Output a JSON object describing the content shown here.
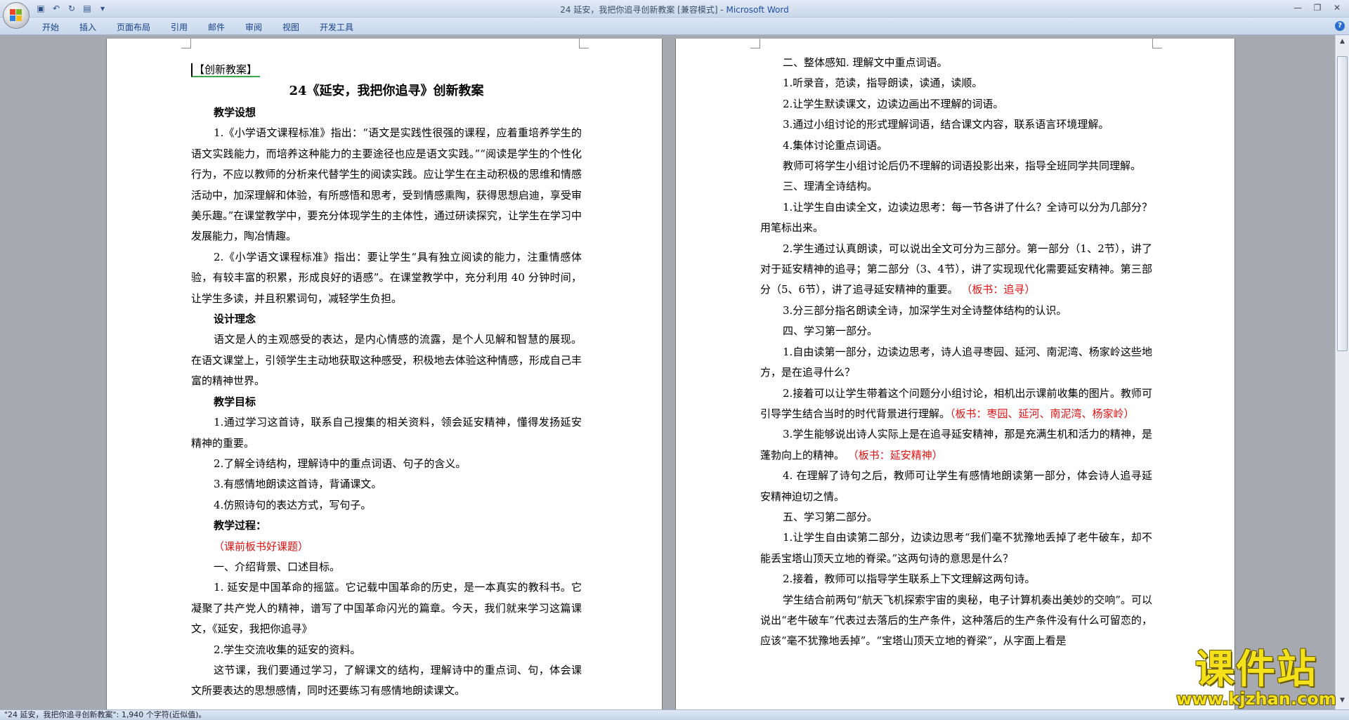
{
  "window": {
    "title_doc": "24 延安，我把你追寻创新教案 [兼容模式] - ",
    "title_app": "Microsoft Word"
  },
  "ribbon": {
    "tabs": [
      "开始",
      "插入",
      "页面布局",
      "引用",
      "邮件",
      "审阅",
      "视图",
      "开发工具"
    ]
  },
  "left_page": {
    "tag": "【创新教案】",
    "title": "24《延安，我把你追寻》创新教案",
    "paragraphs": [
      {
        "text": "教学设想",
        "style": "bold"
      },
      {
        "text": "1.《小学语文课程标准》指出：“语文是实践性很强的课程，应着重培养学生的语文实践能力，而培养这种能力的主要途径也应是语文实践。”“阅读是学生的个性化行为，不应以教师的分析来代替学生的阅读实践。应让学生在主动积极的思维和情感活动中，加深理解和体验，有所感悟和思考，受到情感熏陶，获得思想启迪，享受审美乐趣。”在课堂教学中，要充分体现学生的主体性，通过研读探究，让学生在学习中发展能力，陶冶情趣。",
        "style": "normal"
      },
      {
        "text": "2.《小学语文课程标准》指出：要让学生“具有独立阅读的能力，注重情感体验，有较丰富的积累，形成良好的语感”。在课堂教学中，充分利用 40 分钟时间，让学生多读，并且积累词句，减轻学生负担。",
        "style": "normal"
      },
      {
        "text": "设计理念",
        "style": "bold"
      },
      {
        "text": "语文是人的主观感受的表达，是内心情感的流露，是个人见解和智慧的展现。在语文课堂上，引领学生主动地获取这种感受，积极地去体验这种情感，形成自己丰富的精神世界。",
        "style": "normal"
      },
      {
        "text": "教学目标",
        "style": "bold"
      },
      {
        "text": "1.通过学习这首诗，联系自己搜集的相关资料，领会延安精神，懂得发扬延安精神的重要。",
        "style": "normal"
      },
      {
        "text": "2.了解全诗结构，理解诗中的重点词语、句子的含义。",
        "style": "normal"
      },
      {
        "text": "3.有感情地朗读这首诗，背诵课文。",
        "style": "normal"
      },
      {
        "text": "4.仿照诗句的表达方式，写句子。",
        "style": "normal"
      },
      {
        "text": "教学过程：",
        "style": "bold"
      },
      {
        "text": "（课前板书好课题）",
        "style": "red"
      },
      {
        "text": "一、介绍背景、口述目标。",
        "style": "normal"
      },
      {
        "text": "1. 延安是中国革命的摇篮。它记载中国革命的历史，是一本真实的教科书。它凝聚了共产党人的精神，谱写了中国革命闪光的篇章。今天，我们就来学习这篇课文，《延安，我把你追寻》",
        "style": "normal"
      },
      {
        "text": "2.学生交流收集的延安的资料。",
        "style": "normal"
      },
      {
        "text": "这节课，我们要通过学习，了解课文的结构，理解诗中的重点词、句，体会课文所要表达的思想感情，同时还要练习有感情地朗读课文。",
        "style": "normal"
      }
    ]
  },
  "right_page": {
    "paragraphs": [
      {
        "parts": [
          {
            "text": "二、整体感知. 理解文中重点词语。",
            "color": "black"
          }
        ]
      },
      {
        "parts": [
          {
            "text": "1.听录音，范读，指导朗读，读通，读顺。",
            "color": "black"
          }
        ]
      },
      {
        "parts": [
          {
            "text": "2.让学生默读课文，边读边画出不理解的词语。",
            "color": "black"
          }
        ]
      },
      {
        "parts": [
          {
            "text": "3.通过小组讨论的形式理解词语，结合课文内容，联系语言环境理解。",
            "color": "black"
          }
        ]
      },
      {
        "parts": [
          {
            "text": "4.集体讨论重点词语。",
            "color": "black"
          }
        ]
      },
      {
        "parts": [
          {
            "text": "教师可将学生小组讨论后仍不理解的词语投影出来，指导全班同学共同理解。",
            "color": "black"
          }
        ]
      },
      {
        "parts": [
          {
            "text": "三、理清全诗结构。",
            "color": "black"
          }
        ]
      },
      {
        "parts": [
          {
            "text": "1.让学生自由读全文，边读边思考：每一节各讲了什么？全诗可以分为几部分？用笔标出来。",
            "color": "black"
          }
        ]
      },
      {
        "parts": [
          {
            "text": "2.学生通过认真朗读，可以说出全文可分为三部分。第一部分（1、2节），讲了对于延安精神的追寻；第二部分（3、4节），讲了实现现代化需要延安精神。第三部分（5、6节），讲了追寻延安精神的重要。",
            "color": "black"
          },
          {
            "text": " （板书：追寻）",
            "color": "red"
          }
        ]
      },
      {
        "parts": [
          {
            "text": "3.分三部分指名朗读全诗，加深学生对全诗整体结构的认识。",
            "color": "black"
          }
        ]
      },
      {
        "parts": [
          {
            "text": "四、学习第一部分。",
            "color": "black"
          }
        ]
      },
      {
        "parts": [
          {
            "text": "1.自由读第一部分，边读边思考，诗人追寻枣园、延河、南泥湾、杨家岭这些地方，是在追寻什么？",
            "color": "black"
          }
        ]
      },
      {
        "parts": [
          {
            "text": "2.接着可以让学生带着这个问题分小组讨论，相机出示课前收集的图片。教师可引导学生结合当时的时代背景进行理解。",
            "color": "black"
          },
          {
            "text": "（板书：枣园、延河、南泥湾、杨家岭）",
            "color": "red"
          }
        ]
      },
      {
        "parts": [
          {
            "text": "3.学生能够说出诗人实际上是在追寻延安精神，那是充满生机和活力的精神，是蓬勃向上的精神。",
            "color": "black"
          },
          {
            "text": " （板书：延安精神）",
            "color": "red"
          }
        ]
      },
      {
        "parts": [
          {
            "text": "4. 在理解了诗句之后，教师可让学生有感情地朗读第一部分，体会诗人追寻延安精神迫切之情。",
            "color": "black"
          }
        ]
      },
      {
        "parts": [
          {
            "text": "五、学习第二部分。",
            "color": "black"
          }
        ]
      },
      {
        "parts": [
          {
            "text": "1.让学生自由读第二部分，边读边思考“我们毫不犹豫地丢掉了老牛破车，却不能丢宝塔山顶天立地的脊梁。”这两句诗的意思是什么？",
            "color": "black"
          }
        ]
      },
      {
        "parts": [
          {
            "text": "2.接着，教师可以指导学生联系上下文理解这两句诗。",
            "color": "black"
          }
        ]
      },
      {
        "parts": [
          {
            "text": "学生结合前两句“航天飞机探索宇宙的奥秘，电子计算机奏出美妙的交响”。可以说出“老牛破车”代表过去落后的生产条件，这种落后的生产条件没有什么可留恋的，应该“毫不犹豫地丢掉”。“宝塔山顶天立地的脊梁”，从字面上看是",
            "color": "black"
          }
        ]
      }
    ]
  },
  "status_bar": {
    "text": "\"24 延安，我把你追寻创新教案\": 1,940 个字符(近似值)。"
  },
  "watermark": {
    "big": "课件站",
    "small": "www.kjzhan.com"
  }
}
